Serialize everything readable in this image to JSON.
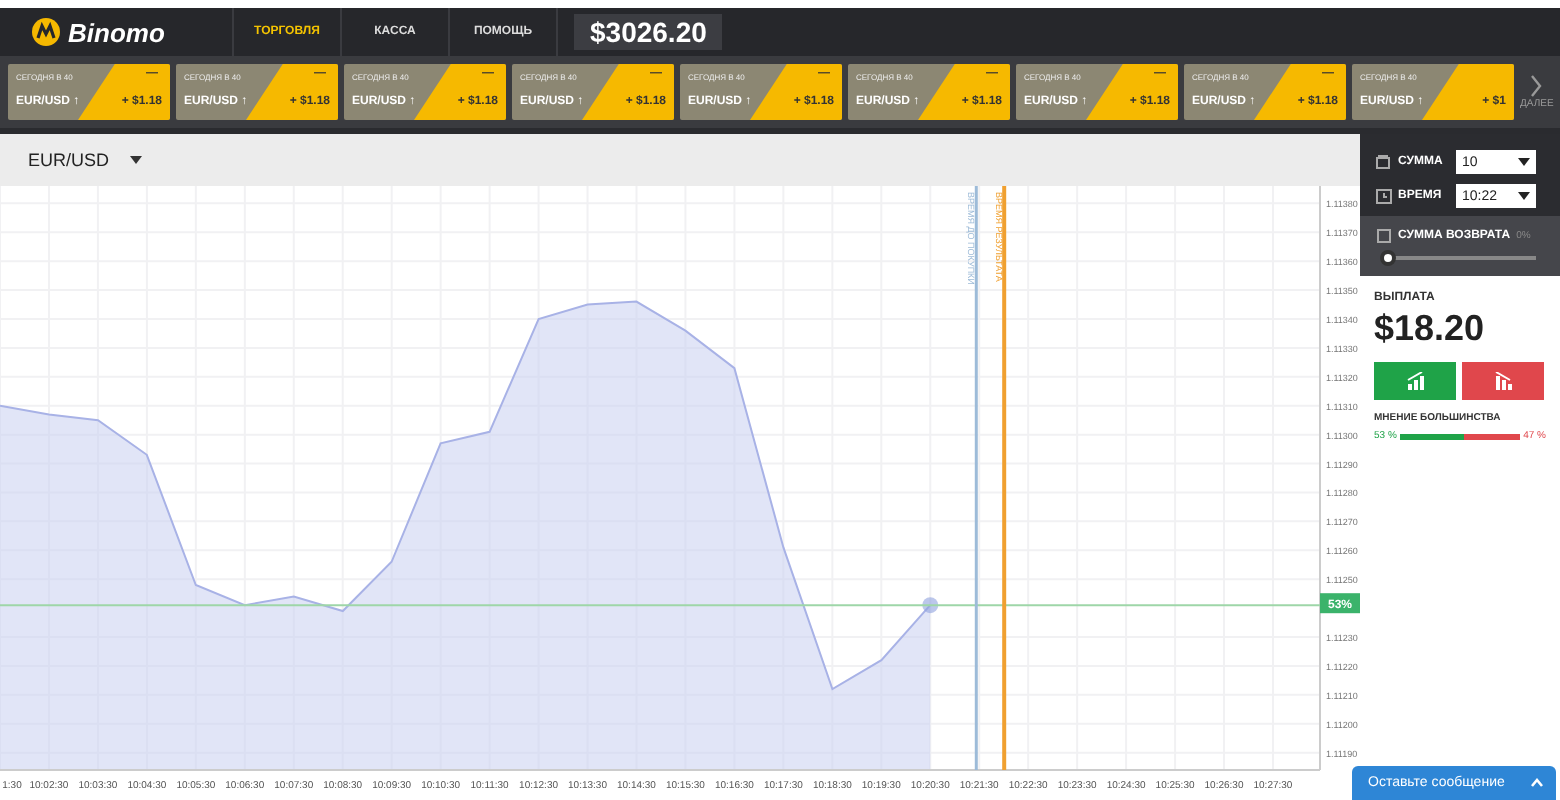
{
  "header": {
    "logo": "Binomo",
    "nav": [
      {
        "label": "ТОРГОВЛЯ",
        "selected": true
      },
      {
        "label": "КАССА",
        "selected": false
      },
      {
        "label": "ПОМОЩЬ",
        "selected": false
      }
    ],
    "balance": "$3026.20"
  },
  "cards": [
    {
      "title": "СЕГОДНЯ В 40",
      "asset": "EUR/USD ↑",
      "mark": "—",
      "payout": "+ $1.18"
    },
    {
      "title": "СЕГОДНЯ В 40",
      "asset": "EUR/USD ↑",
      "mark": "—",
      "payout": "+ $1.18"
    },
    {
      "title": "СЕГОДНЯ В 40",
      "asset": "EUR/USD ↑",
      "mark": "—",
      "payout": "+ $1.18"
    },
    {
      "title": "СЕГОДНЯ В 40",
      "asset": "EUR/USD ↑",
      "mark": "—",
      "payout": "+ $1.18"
    },
    {
      "title": "СЕГОДНЯ В 40",
      "asset": "EUR/USD ↑",
      "mark": "—",
      "payout": "+ $1.18"
    },
    {
      "title": "СЕГОДНЯ В 40",
      "asset": "EUR/USD ↑",
      "mark": "—",
      "payout": "+ $1.18"
    },
    {
      "title": "СЕГОДНЯ В 40",
      "asset": "EUR/USD ↑",
      "mark": "—",
      "payout": "+ $1.18"
    },
    {
      "title": "СЕГОДНЯ В 40",
      "asset": "EUR/USD ↑",
      "mark": "—",
      "payout": "+ $1.18"
    },
    {
      "title": "СЕГОДНЯ В 40",
      "asset": "EUR/USD ↑",
      "payout": "+ $1"
    }
  ],
  "cards_next": {
    "label": "ДАЛЕЕ"
  },
  "chart": {
    "current_badge": "53%",
    "markers": [
      {
        "label": "ВРЕМЯ ДО ПОКУПКИ",
        "color": "#9dbbd8"
      },
      {
        "label": "ВРЕМЯ РЕЗУЛЬТАТА",
        "color": "#f0a030"
      }
    ],
    "chart_data": {
      "type": "area",
      "grid": true,
      "categories": [
        "1:30",
        "10:02:30",
        "10:03:30",
        "10:04:30",
        "10:05:30",
        "10:06:30",
        "10:07:30",
        "10:08:30",
        "10:09:30",
        "10:10:30",
        "10:11:30",
        "10:12:30",
        "10:13:30",
        "10:14:30",
        "10:15:30",
        "10:16:30",
        "10:17:30",
        "10:18:30",
        "10:19:30",
        "10:20:30",
        "10:21:30",
        "10:22:30",
        "10:23:30",
        "10:24:30",
        "10:25:30",
        "10:26:30",
        "10:27:30"
      ],
      "series": [
        {
          "name": "EUR/USD",
          "color": "#c9cff0",
          "values": [
            1.1131,
            1.11307,
            1.11305,
            1.11293,
            1.11248,
            1.11241,
            1.11244,
            1.11239,
            1.11256,
            1.11297,
            1.11301,
            1.1134,
            1.11345,
            1.11346,
            1.11336,
            1.11323,
            1.11261,
            1.11212,
            1.11222,
            1.11241,
            null,
            null,
            null,
            null,
            null,
            null,
            null
          ]
        }
      ],
      "ylim": [
        1.11184,
        1.11386
      ],
      "yticks": [
        {
          "value": 1.1138,
          "label": "1.11380"
        },
        {
          "value": 1.1137,
          "label": "1.11370"
        },
        {
          "value": 1.1136,
          "label": "1.11360"
        },
        {
          "value": 1.1135,
          "label": "1.11350"
        },
        {
          "value": 1.1134,
          "label": "1.11340"
        },
        {
          "value": 1.1133,
          "label": "1.11330"
        },
        {
          "value": 1.1132,
          "label": "1.11320"
        },
        {
          "value": 1.1131,
          "label": "1.11310"
        },
        {
          "value": 1.113,
          "label": "1.11300"
        },
        {
          "value": 1.1129,
          "label": "1.11290"
        },
        {
          "value": 1.1128,
          "label": "1.11280"
        },
        {
          "value": 1.1127,
          "label": "1.11270"
        },
        {
          "value": 1.1126,
          "label": "1.11260"
        },
        {
          "value": 1.1125,
          "label": "1.11250"
        },
        {
          "value": 1.1123,
          "label": "1.11230"
        },
        {
          "value": 1.1122,
          "label": "1.11220"
        },
        {
          "value": 1.1121,
          "label": "1.11210"
        },
        {
          "value": 1.112,
          "label": "1.11200"
        },
        {
          "value": 1.1119,
          "label": "1.11190"
        }
      ]
    }
  },
  "panel": {
    "amount": {
      "label": "СУММА",
      "value": "10"
    },
    "time": {
      "label": "ВРЕМЯ",
      "value": "10:22"
    },
    "refund": {
      "label": "СУММА ВОЗВРАТА",
      "percent": "0%",
      "level": 0
    },
    "payout_label": "ВЫПЛАТА",
    "payout": "$18.20",
    "majority": {
      "label": "МНЕНИЕ БОЛЬШИНСТВА",
      "up": "53 %",
      "down": "47 %",
      "level": 0.53
    }
  },
  "chat": {
    "label": "Оставьте сообщение"
  }
}
